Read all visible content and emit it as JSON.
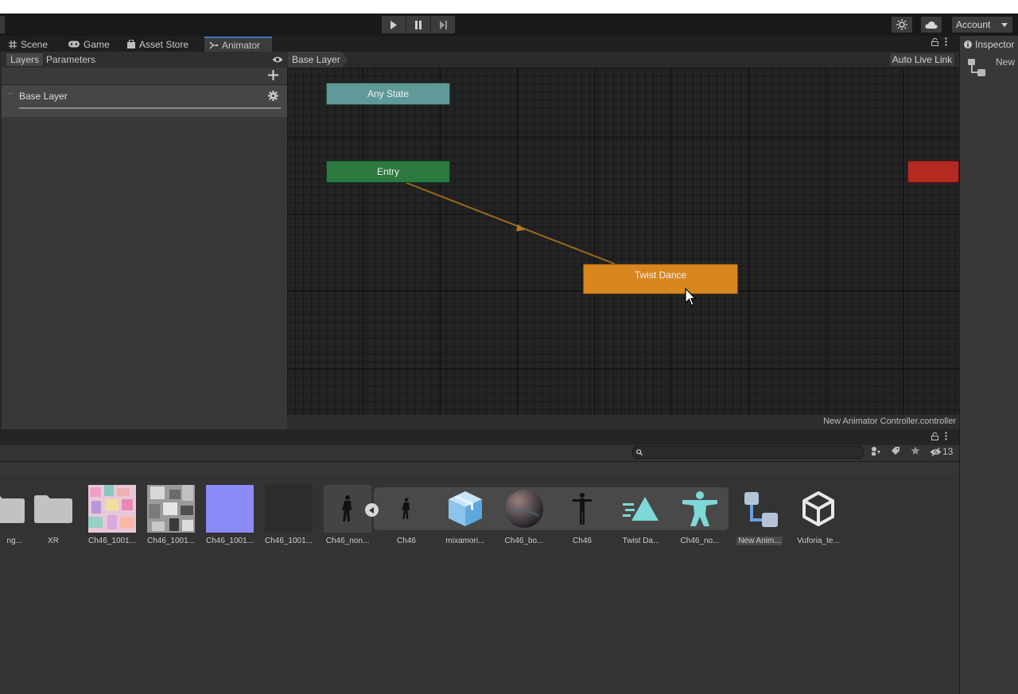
{
  "toolbar": {
    "account_label": "Account",
    "play_icon": "play-icon",
    "pause_icon": "pause-icon",
    "step_icon": "step-icon"
  },
  "tabs": [
    {
      "label": "Scene",
      "icon": "grid-icon"
    },
    {
      "label": "Game",
      "icon": "gamepad-icon"
    },
    {
      "label": "Asset Store",
      "icon": "bag-icon"
    },
    {
      "label": "Animator",
      "icon": "animator-icon",
      "active": true
    }
  ],
  "animator": {
    "subtabs": [
      "Layers",
      "Parameters"
    ],
    "active_subtab": "Layers",
    "layer_name": "Base Layer",
    "breadcrumb": "Base Layer",
    "auto_live_link": "Auto Live Link",
    "controller_name": "New Animator Controller.controller",
    "states": {
      "any_state": "Any State",
      "entry": "Entry",
      "twist_dance": "Twist Dance"
    },
    "colors": {
      "any_state": "#5f9a99",
      "entry": "#2c7a3f",
      "default_state": "#d9861f",
      "exit": "#b42a20",
      "transition": "#9a6a1f"
    }
  },
  "inspector": {
    "title": "Inspector",
    "item_name": "New"
  },
  "project": {
    "hidden_count": "13",
    "assets": [
      {
        "label": "ng...",
        "type": "folder"
      },
      {
        "label": "XR",
        "type": "folder"
      },
      {
        "label": "Ch46_1001...",
        "type": "texture-pink"
      },
      {
        "label": "Ch46_1001...",
        "type": "texture-gray"
      },
      {
        "label": "Ch46_1001...",
        "type": "texture-normal"
      },
      {
        "label": "Ch46_1001...",
        "type": "texture-dark"
      },
      {
        "label": "Ch46_non...",
        "type": "model-silhouette"
      },
      {
        "label": "Ch46",
        "type": "model-silhouette"
      },
      {
        "label": "mixamori...",
        "type": "prefab-cube"
      },
      {
        "label": "Ch46_bo...",
        "type": "material-sphere"
      },
      {
        "label": "Ch46",
        "type": "avatar-tpose"
      },
      {
        "label": "Twist Da...",
        "type": "animation-clip"
      },
      {
        "label": "Ch46_no...",
        "type": "avatar-humanoid"
      },
      {
        "label": "New Anim...",
        "type": "animator-controller",
        "selected": true
      },
      {
        "label": "Vuforia_te...",
        "type": "unity-logo"
      }
    ]
  }
}
